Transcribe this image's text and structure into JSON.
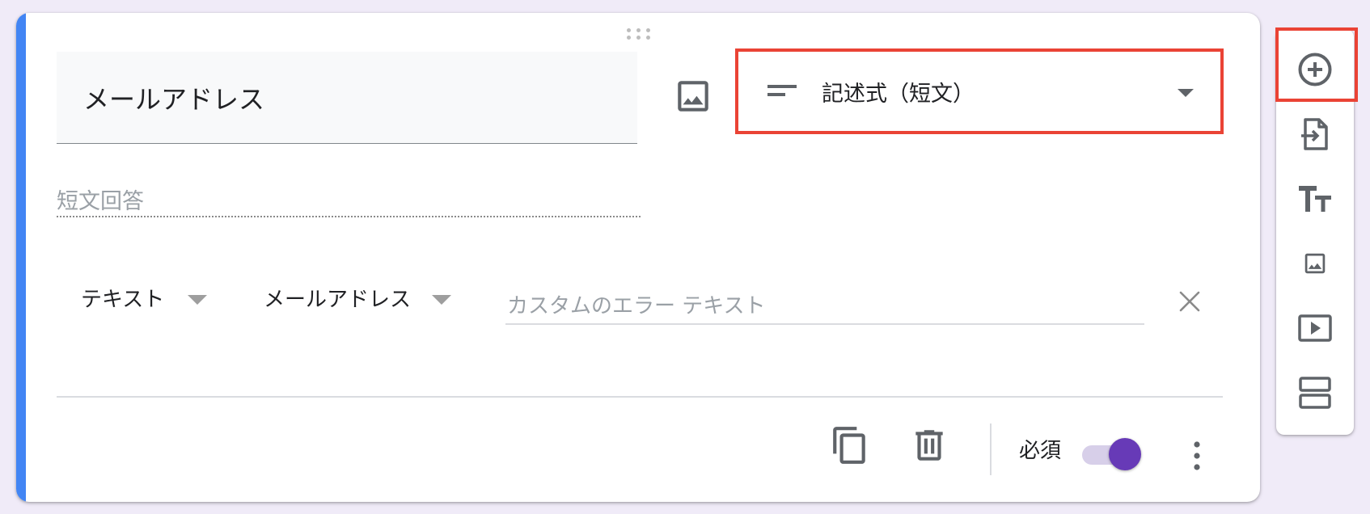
{
  "question": {
    "title": "メールアドレス",
    "type_label": "記述式（短文）",
    "answer_hint": "短文回答"
  },
  "validation": {
    "type": "テキスト",
    "condition": "メールアドレス",
    "error_placeholder": "カスタムのエラー テキスト"
  },
  "footer": {
    "required_label": "必須",
    "required_on": true
  },
  "colors": {
    "accent": "#4285f4",
    "toggle": "#673ab7",
    "highlight": "#ea4335",
    "background": "#f0ebf8"
  },
  "icons": {
    "toolbar": [
      "add-question-icon",
      "import-questions-icon",
      "title-description-icon",
      "add-image-icon",
      "add-video-icon",
      "add-section-icon"
    ],
    "footer": [
      "duplicate-icon",
      "delete-icon",
      "more-vert-icon"
    ]
  }
}
